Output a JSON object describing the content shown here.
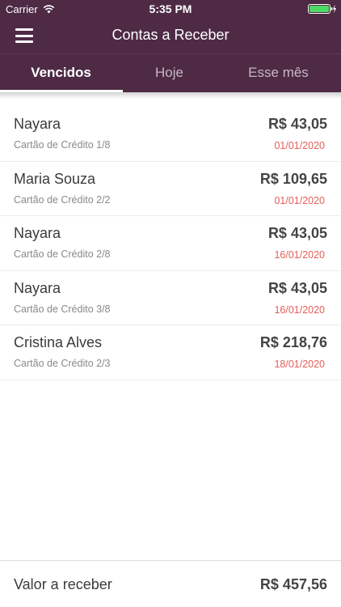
{
  "status_bar": {
    "carrier": "Carrier",
    "time": "5:35 PM"
  },
  "nav": {
    "title": "Contas a Receber",
    "menu_icon": "hamburger-menu-icon"
  },
  "tabs": [
    {
      "label": "Vencidos",
      "active": true
    },
    {
      "label": "Hoje",
      "active": false
    },
    {
      "label": "Esse mês",
      "active": false
    }
  ],
  "items": [
    {
      "name": "Nayara",
      "description": "Cartão de Crédito 1/8",
      "value": "R$ 43,05",
      "date": "01/01/2020"
    },
    {
      "name": "Maria Souza",
      "description": "Cartão de Crédito 2/2",
      "value": "R$ 109,65",
      "date": "01/01/2020"
    },
    {
      "name": "Nayara",
      "description": "Cartão de Crédito 2/8",
      "value": "R$ 43,05",
      "date": "16/01/2020"
    },
    {
      "name": "Nayara",
      "description": "Cartão de Crédito 3/8",
      "value": "R$ 43,05",
      "date": "16/01/2020"
    },
    {
      "name": "Cristina Alves",
      "description": "Cartão de Crédito 2/3",
      "value": "R$ 218,76",
      "date": "18/01/2020"
    }
  ],
  "footer": {
    "label": "Valor a receber",
    "value": "R$ 457,56"
  },
  "colors": {
    "header": "#4e2a45",
    "date": "#e3605a",
    "battery": "#4cd964"
  }
}
